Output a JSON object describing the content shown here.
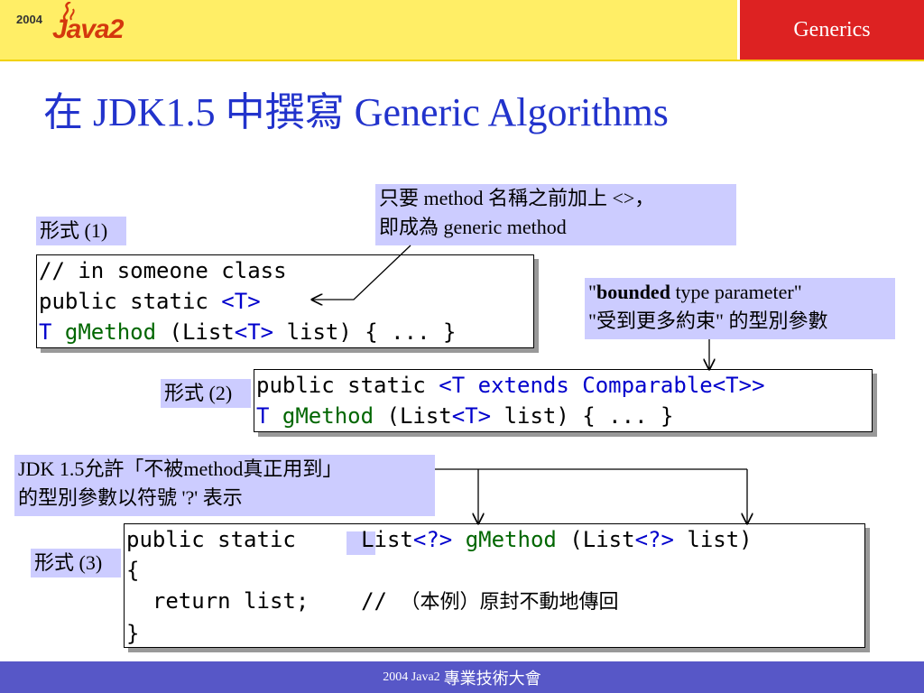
{
  "header": {
    "logo_year": "2004",
    "logo_text": "Java2",
    "tab_label": "Generics"
  },
  "title": "在 JDK1.5 中撰寫 Generic Algorithms",
  "callouts": {
    "generic_method_line1": "只要 method 名稱之前加上 <>，",
    "generic_method_line2": "即成為 generic method",
    "bounded_line1_prefix": "\"",
    "bounded_line1_bold": "bounded",
    "bounded_line1_rest": " type parameter\"",
    "bounded_line2": "\"受到更多約束\" 的型別參數",
    "jdk_line1": "JDK 1.5允許「不被method真正用到」",
    "jdk_line2": "的型別參數以符號 '?' 表示"
  },
  "forms": {
    "form1_label": "形式 (1)",
    "form2_label": "形式 (2)",
    "form3_label": "形式 (3)"
  },
  "code1": {
    "line1": "// in someone class",
    "line2_a": "public static ",
    "line2_b": "<T>",
    "line3_a": "T ",
    "line3_b": "gMethod",
    "line3_c": " (List",
    "line3_d": "<T>",
    "line3_e": " list) { ... }"
  },
  "code2": {
    "line1_a": "public static ",
    "line1_b": "<T extends Comparable<T>>",
    "line2_a": "T ",
    "line2_b": "gMethod",
    "line2_c": " (List",
    "line2_d": "<T>",
    "line2_e": " list) { ... }"
  },
  "code3": {
    "line1_a": "public static     List",
    "line1_b": "<?>",
    "line1_c": " ",
    "line1_d": "gMethod",
    "line1_e": " (List",
    "line1_f": "<?>",
    "line1_g": " list)",
    "line2": "{",
    "line3_a": "  return list;    // ",
    "line3_b": "（本例）原封不動地傳回",
    "line4": "}"
  },
  "footer": {
    "prefix": "2004 Java2",
    "text": "專業技術大會"
  }
}
